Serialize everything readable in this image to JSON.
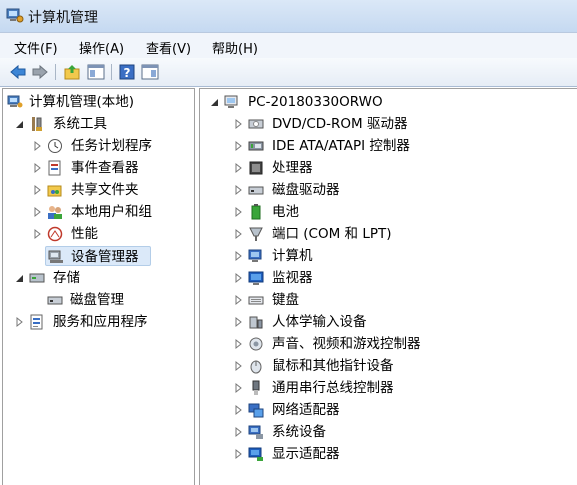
{
  "window": {
    "title": "计算机管理"
  },
  "menu": [
    "文件(F)",
    "操作(A)",
    "查看(V)",
    "帮助(H)"
  ],
  "toolbar": {
    "buttons": [
      {
        "name": "back-button",
        "icon": "back-arrow-icon"
      },
      {
        "name": "forward-button",
        "icon": "forward-arrow-icon"
      },
      {
        "name": "up-folder-button",
        "icon": "up-folder-icon"
      },
      {
        "name": "show-hide-tree-button",
        "icon": "console-tree-icon"
      },
      {
        "name": "help-button",
        "icon": "help-icon"
      },
      {
        "name": "show-action-pane-button",
        "icon": "action-pane-icon"
      }
    ]
  },
  "left_tree": {
    "root": "计算机管理(本地)",
    "system_tools": "系统工具",
    "task_scheduler": "任务计划程序",
    "event_viewer": "事件查看器",
    "shared_folders": "共享文件夹",
    "local_users": "本地用户和组",
    "performance": "性能",
    "device_manager": "设备管理器",
    "storage": "存储",
    "disk_management": "磁盘管理",
    "services_apps": "服务和应用程序"
  },
  "device_tree": {
    "computer_name": "PC-20180330ORWO",
    "categories": [
      {
        "label": "DVD/CD-ROM 驱动器",
        "icon": "dvd-drive-icon"
      },
      {
        "label": "IDE ATA/ATAPI 控制器",
        "icon": "ide-controller-icon"
      },
      {
        "label": "处理器",
        "icon": "processor-icon"
      },
      {
        "label": "磁盘驱动器",
        "icon": "disk-drive-icon"
      },
      {
        "label": "电池",
        "icon": "battery-icon"
      },
      {
        "label": "端口 (COM 和 LPT)",
        "icon": "port-icon"
      },
      {
        "label": "计算机",
        "icon": "computer-icon"
      },
      {
        "label": "监视器",
        "icon": "monitor-icon"
      },
      {
        "label": "键盘",
        "icon": "keyboard-icon"
      },
      {
        "label": "人体学输入设备",
        "icon": "hid-icon"
      },
      {
        "label": "声音、视频和游戏控制器",
        "icon": "sound-icon"
      },
      {
        "label": "鼠标和其他指针设备",
        "icon": "mouse-icon"
      },
      {
        "label": "通用串行总线控制器",
        "icon": "usb-icon"
      },
      {
        "label": "网络适配器",
        "icon": "network-adapter-icon"
      },
      {
        "label": "系统设备",
        "icon": "system-device-icon"
      },
      {
        "label": "显示适配器",
        "icon": "display-adapter-icon"
      }
    ]
  }
}
